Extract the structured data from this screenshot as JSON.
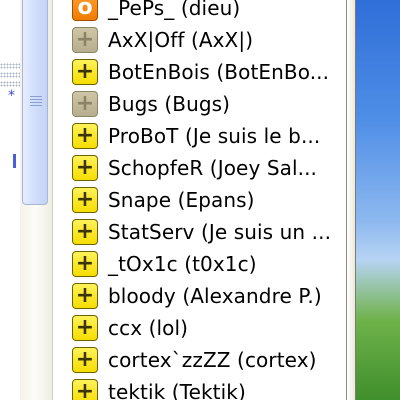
{
  "users": [
    {
      "label": "_PePs_ (dieu)",
      "badge": "o",
      "status": "op"
    },
    {
      "label": "AxX|Off (AxX|)",
      "badge": "+",
      "status": "away"
    },
    {
      "label": "BotEnBois (BotEnBo...",
      "badge": "+",
      "status": "voice"
    },
    {
      "label": "Bugs (Bugs)",
      "badge": "+",
      "status": "away"
    },
    {
      "label": "ProBoT (Je suis le b...",
      "badge": "+",
      "status": "voice"
    },
    {
      "label": "SchopfeR (Joey Sal...",
      "badge": "+",
      "status": "voice"
    },
    {
      "label": "Snape (Epans)",
      "badge": "+",
      "status": "voice"
    },
    {
      "label": "StatServ (Je suis un ...",
      "badge": "+",
      "status": "voice"
    },
    {
      "label": "_tOx1c (t0x1c)",
      "badge": "+",
      "status": "voice"
    },
    {
      "label": "bloody (Alexandre P.)",
      "badge": "+",
      "status": "voice"
    },
    {
      "label": "ccx (lol)",
      "badge": "+",
      "status": "voice"
    },
    {
      "label": "cortex`zzZZ (cortex)",
      "badge": "+",
      "status": "voice"
    },
    {
      "label": "tektik (Tektik)",
      "badge": "+",
      "status": "voice"
    }
  ],
  "left_pane_mark": "*",
  "colors": {
    "voice_badge": "#ffec1c",
    "away_badge": "#c3ba98",
    "op_badge": "#f58a10",
    "scroll_thumb": "#d3defb",
    "link_blue": "#3a4fd8"
  }
}
